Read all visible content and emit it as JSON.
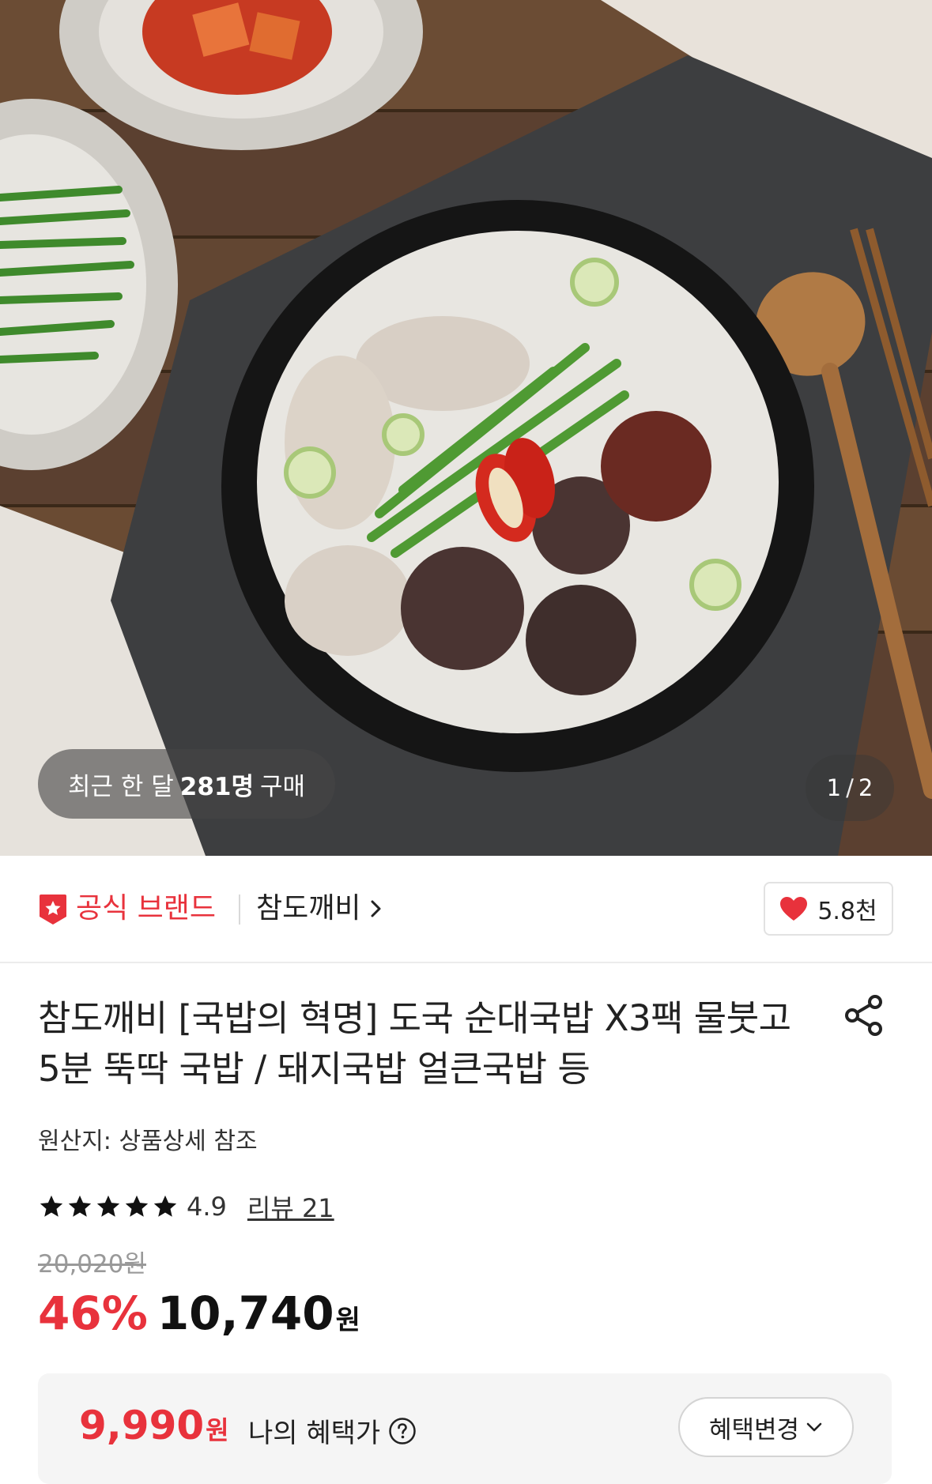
{
  "hero": {
    "purchase_prefix": "최근 한 달",
    "purchase_count": "281명",
    "purchase_suffix": "구매",
    "page_current": "1",
    "page_separator": "/",
    "page_total": "2"
  },
  "brand": {
    "official_label": "공식 브랜드",
    "brand_name": "참도깨비",
    "like_count": "5.8천"
  },
  "product": {
    "title": "참도깨비 [국밥의 혁명] 도국 순대국밥 X3팩 물붓고 5분 뚝딱 국밥 / 돼지국밥 얼큰국밥 등",
    "origin": "원산지: 상품상세 참조",
    "rating": "4.9",
    "review_label": "리뷰 21",
    "original_price": "20,020원",
    "discount": "46%",
    "price": "10,740",
    "price_unit": "원"
  },
  "benefit": {
    "price": "9,990",
    "price_unit": "원",
    "label": "나의 혜택가",
    "change_button": "혜택변경"
  },
  "colors": {
    "accent_red": "#e8323c",
    "text_dark": "#222222",
    "text_muted": "#999999",
    "benefit_bg": "#f5f5f5"
  },
  "icons": {
    "badge": "official-star-badge-icon",
    "chevron": "chevron-right-icon",
    "heart": "heart-icon",
    "share": "share-icon",
    "star": "star-icon",
    "help": "question-circle-icon",
    "dropdown": "chevron-down-icon"
  }
}
